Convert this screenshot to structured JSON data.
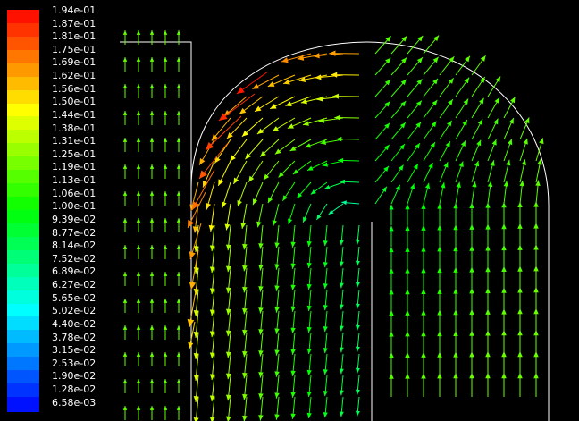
{
  "chart_data": {
    "type": "vector field",
    "colormap": "rainbow (blue to red)",
    "range": [
      0.00658,
      0.194
    ],
    "colorbar_labels": [
      "1.94e-01",
      "1.87e-01",
      "1.81e-01",
      "1.75e-01",
      "1.69e-01",
      "1.62e-01",
      "1.56e-01",
      "1.50e-01",
      "1.44e-01",
      "1.38e-01",
      "1.31e-01",
      "1.25e-01",
      "1.19e-01",
      "1.13e-01",
      "1.06e-01",
      "1.00e-01",
      "9.39e-02",
      "8.77e-02",
      "8.14e-02",
      "7.52e-02",
      "6.89e-02",
      "6.27e-02",
      "5.65e-02",
      "5.02e-02",
      "4.40e-02",
      "3.78e-02",
      "3.15e-02",
      "2.53e-02",
      "1.90e-02",
      "1.28e-02",
      "6.58e-03"
    ],
    "background": "#000000",
    "geometry_color": "#ffffff"
  }
}
